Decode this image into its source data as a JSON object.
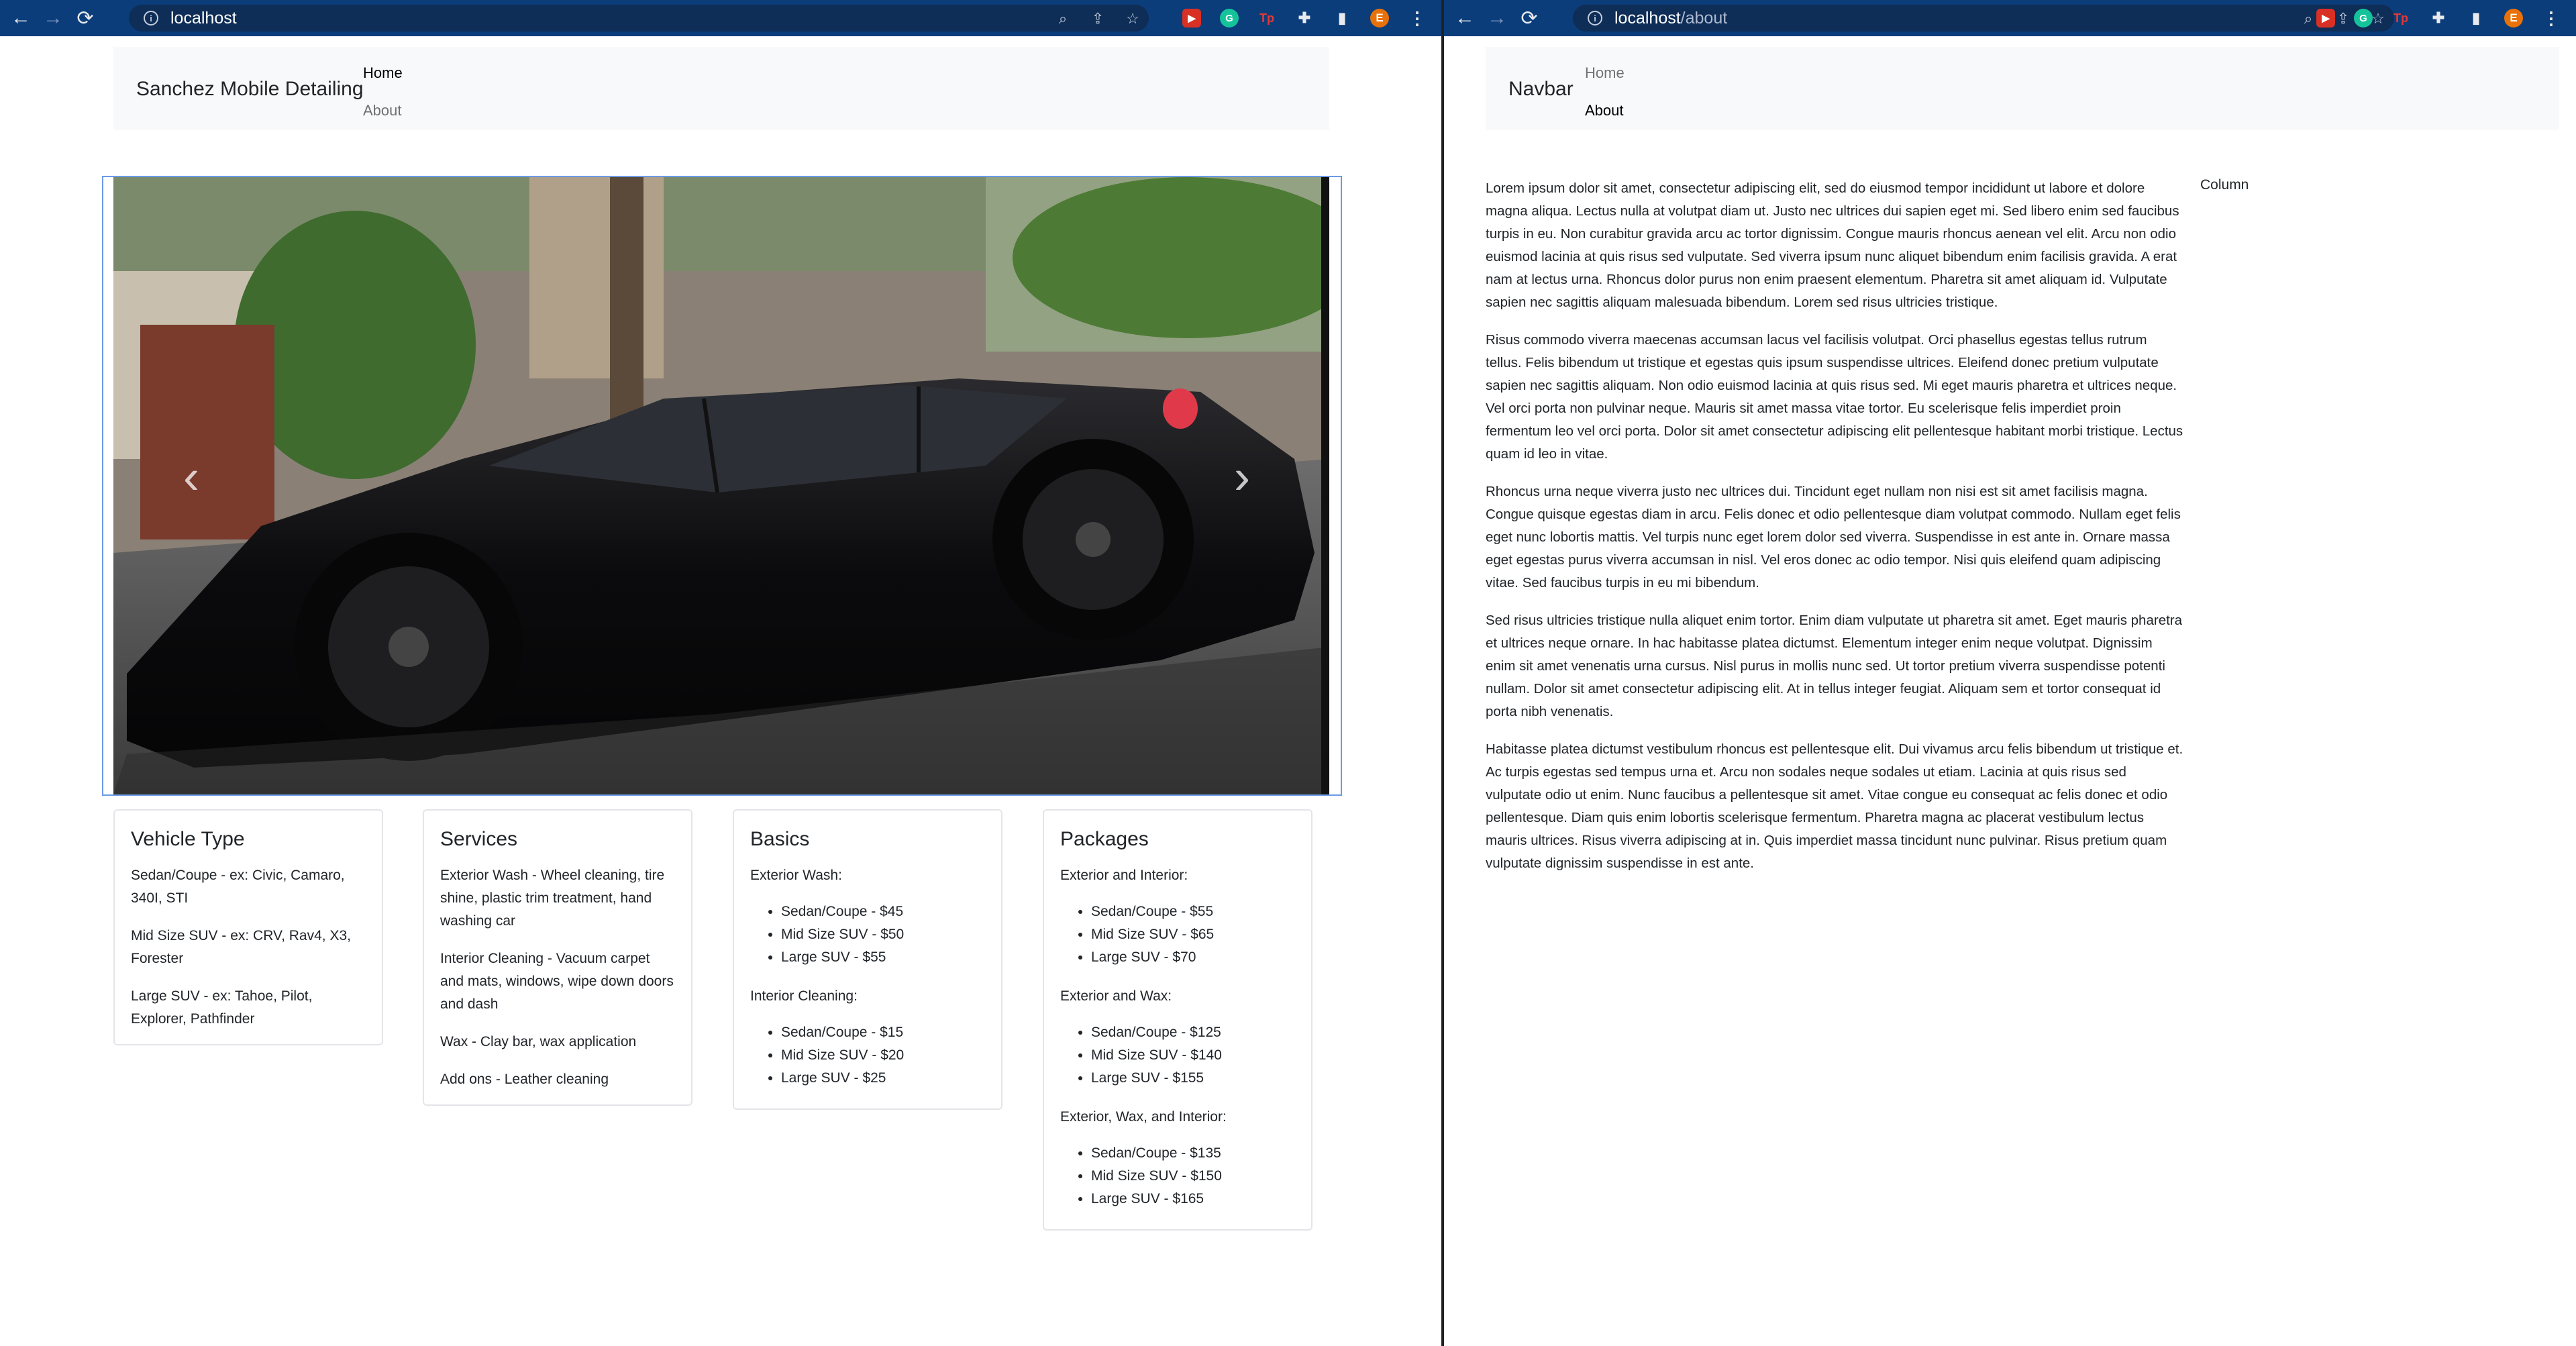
{
  "left_window": {
    "omnibox": {
      "url": "localhost"
    },
    "page": {
      "brand": "Sanchez Mobile Detailing",
      "nav": [
        {
          "label": "Home",
          "active": true
        },
        {
          "label": "About",
          "active": false
        }
      ],
      "carousel": {
        "prev_glyph": "‹",
        "next_glyph": "›"
      },
      "cards": [
        {
          "title": "Vehicle Type",
          "lines": [
            "Sedan/Coupe - ex: Civic, Camaro, 340I, STI",
            "Mid Size SUV - ex: CRV, Rav4, X3, Forester",
            "Large SUV - ex: Tahoe, Pilot, Explorer, Pathfinder"
          ]
        },
        {
          "title": "Services",
          "lines": [
            "Exterior Wash - Wheel cleaning, tire shine, plastic trim treatment, hand washing car",
            "Interior Cleaning - Vacuum carpet and mats, windows, wipe down doors and dash",
            "Wax - Clay bar, wax application",
            "Add ons - Leather cleaning"
          ]
        },
        {
          "title": "Basics",
          "groups": [
            {
              "heading": "Exterior Wash:",
              "items": [
                "Sedan/Coupe - $45",
                "Mid Size SUV - $50",
                "Large SUV - $55"
              ]
            },
            {
              "heading": "Interior Cleaning:",
              "items": [
                "Sedan/Coupe - $15",
                "Mid Size SUV - $20",
                "Large SUV - $25"
              ]
            }
          ]
        },
        {
          "title": "Packages",
          "groups": [
            {
              "heading": "Exterior and Interior:",
              "items": [
                "Sedan/Coupe - $55",
                "Mid Size SUV - $65",
                "Large SUV - $70"
              ]
            },
            {
              "heading": "Exterior and Wax:",
              "items": [
                "Sedan/Coupe - $125",
                "Mid Size SUV - $140",
                "Large SUV - $155"
              ]
            },
            {
              "heading": "Exterior, Wax, and Interior:",
              "items": [
                "Sedan/Coupe - $135",
                "Mid Size SUV - $150",
                "Large SUV - $165"
              ]
            }
          ]
        }
      ]
    }
  },
  "right_window": {
    "omnibox": {
      "host": "localhost",
      "path": "/about"
    },
    "page": {
      "brand": "Navbar",
      "nav": [
        {
          "label": "Home",
          "active": false
        },
        {
          "label": "About",
          "active": true
        }
      ],
      "column_label": "Column",
      "paragraphs": [
        "Lorem ipsum dolor sit amet, consectetur adipiscing elit, sed do eiusmod tempor incididunt ut labore et dolore magna aliqua. Lectus nulla at volutpat diam ut. Justo nec ultrices dui sapien eget mi. Sed libero enim sed faucibus turpis in eu. Non curabitur gravida arcu ac tortor dignissim. Congue mauris rhoncus aenean vel elit. Arcu non odio euismod lacinia at quis risus sed vulputate. Sed viverra ipsum nunc aliquet bibendum enim facilisis gravida. A erat nam at lectus urna. Rhoncus dolor purus non enim praesent elementum. Pharetra sit amet aliquam id. Vulputate sapien nec sagittis aliquam malesuada bibendum. Lorem sed risus ultricies tristique.",
        "Risus commodo viverra maecenas accumsan lacus vel facilisis volutpat. Orci phasellus egestas tellus rutrum tellus. Felis bibendum ut tristique et egestas quis ipsum suspendisse ultrices. Eleifend donec pretium vulputate sapien nec sagittis aliquam. Non odio euismod lacinia at quis risus sed. Mi eget mauris pharetra et ultrices neque. Vel orci porta non pulvinar neque. Mauris sit amet massa vitae tortor. Eu scelerisque felis imperdiet proin fermentum leo vel orci porta. Dolor sit amet consectetur adipiscing elit pellentesque habitant morbi tristique. Lectus quam id leo in vitae.",
        "Rhoncus urna neque viverra justo nec ultrices dui. Tincidunt eget nullam non nisi est sit amet facilisis magna. Congue quisque egestas diam in arcu. Felis donec et odio pellentesque diam volutpat commodo. Nullam eget felis eget nunc lobortis mattis. Vel turpis nunc eget lorem dolor sed viverra. Suspendisse in est ante in. Ornare massa eget egestas purus viverra accumsan in nisl. Vel eros donec ac odio tempor. Nisi quis eleifend quam adipiscing vitae. Sed faucibus turpis in eu mi bibendum.",
        "Sed risus ultricies tristique nulla aliquet enim tortor. Enim diam vulputate ut pharetra sit amet. Eget mauris pharetra et ultrices neque ornare. In hac habitasse platea dictumst. Elementum integer enim neque volutpat. Dignissim enim sit amet venenatis urna cursus. Nisl purus in mollis nunc sed. Ut tortor pretium viverra suspendisse potenti nullam. Dolor sit amet consectetur adipiscing elit. At in tellus integer feugiat. Aliquam sem et tortor consequat id porta nibh venenatis.",
        "Habitasse platea dictumst vestibulum rhoncus est pellentesque elit. Dui vivamus arcu felis bibendum ut tristique et. Ac turpis egestas sed tempus urna et. Arcu non sodales neque sodales ut etiam. Lacinia at quis risus sed vulputate odio ut enim. Nunc faucibus a pellentesque sit amet. Vitae congue eu consequat ac felis donec et odio pellentesque. Diam quis enim lobortis scelerisque fermentum. Pharetra magna ac placerat vestibulum lectus mauris ultrices. Risus viverra adipiscing at in. Quis imperdiet massa tincidunt nunc pulvinar. Risus pretium quam vulputate dignissim suspendisse in est ante."
      ]
    }
  },
  "chrome": {
    "icons": {
      "back": "←",
      "forward": "→",
      "reload": "⟳",
      "info": "i",
      "zoom": "⌕",
      "share": "⇪",
      "star": "☆",
      "puzzle": "✚",
      "sidepanel": "▮",
      "menu": "⋮"
    },
    "extensions": [
      {
        "name": "extension-red-icon",
        "glyph": "▶",
        "color": "#d93025"
      },
      {
        "name": "extension-grammarly-icon",
        "glyph": "G",
        "color": "#15c39a"
      },
      {
        "name": "extension-tp-icon",
        "glyph": "Tp",
        "color": "#e53935"
      }
    ],
    "profile": {
      "initial": "E",
      "color": "#e8710a"
    }
  }
}
